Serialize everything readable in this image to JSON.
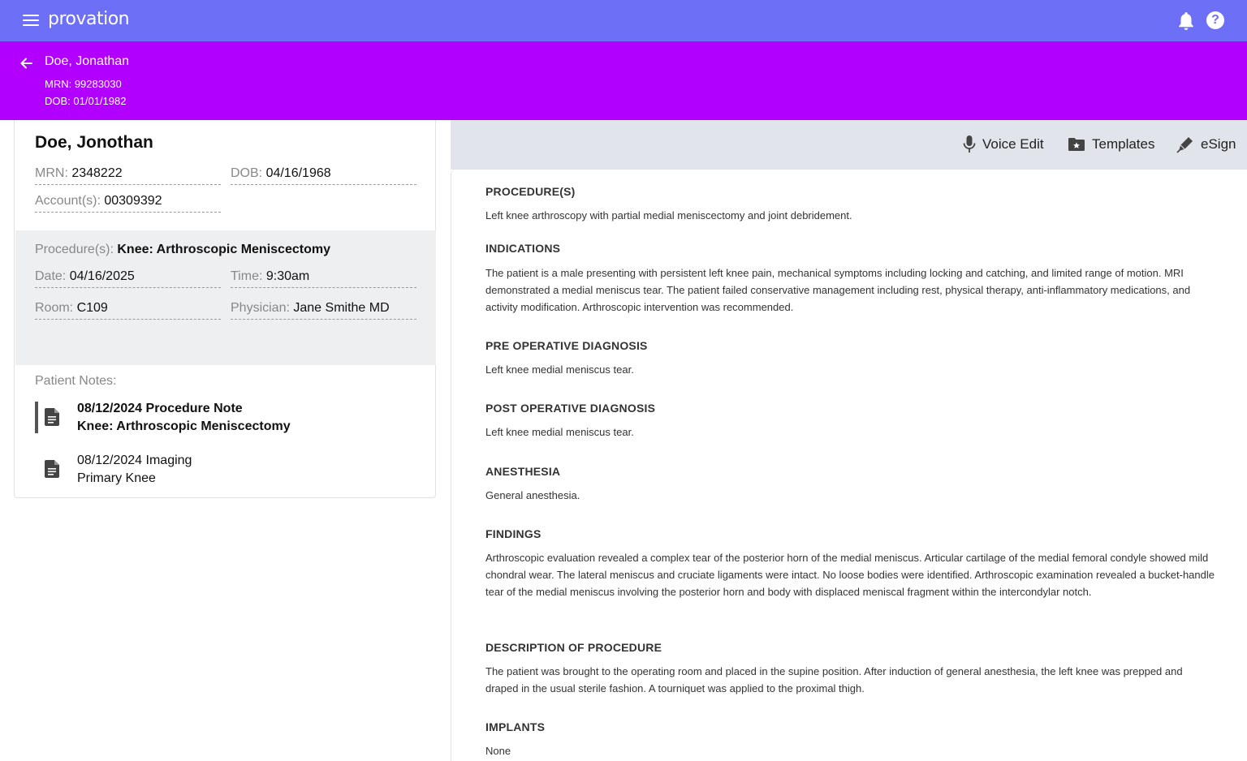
{
  "app": {
    "logo": "provation",
    "menu_icon": "hamburger-menu-icon",
    "bell_icon": "bell-icon",
    "help_icon": "help-icon",
    "help_glyph": "?"
  },
  "patient_header": {
    "name": "Doe, Jonathan",
    "mrn": "MRN: 99283030",
    "dob": "DOB: 01/01/1982"
  },
  "patient_card": {
    "name": "Doe, Jonothan",
    "mrn_label": "MRN: ",
    "mrn_value": "2348222",
    "dob_label": "DOB: ",
    "dob_value": "04/16/1968",
    "account_label": "Account(s): ",
    "account_value": "00309392",
    "procedure_label": "Procedure(s): ",
    "procedure_value": "Knee: Arthroscopic Meniscectomy",
    "date_label": "Date: ",
    "date_value": "04/16/2025",
    "time_label": "Time: ",
    "time_value": "9:30am",
    "room_label": "Room: ",
    "room_value": "C109",
    "physician_label": "Physician: ",
    "physician_value": "Jane Smithe MD",
    "notes_label": "Patient Notes:",
    "notes": [
      {
        "line1": "08/12/2024 Procedure Note",
        "line2": "Knee: Arthroscopic Meniscectomy",
        "active": true
      },
      {
        "line1": "08/12/2024 Imaging",
        "line2": "Primary Knee",
        "active": false
      }
    ]
  },
  "toolbar": {
    "voice_edit": "Voice Edit",
    "templates": "Templates",
    "esign": "eSign"
  },
  "report": {
    "procedures_h": "PROCEDURE(S)",
    "procedures_p": "Left knee arthroscopy with partial medial meniscectomy and joint debridement.",
    "indications_h": "INDICATIONS",
    "indications_p": "The patient is a male presenting with persistent left knee pain, mechanical symptoms including locking and catching, and limited range of motion. MRI demonstrated a medial meniscus tear. The patient failed conservative management including rest, physical therapy, anti-inflammatory medications, and activity modification. Arthroscopic intervention was recommended.",
    "preop_h": "PRE OPERATIVE DIAGNOSIS",
    "preop_p": "Left knee medial meniscus tear.",
    "postop_h": "POST OPERATIVE DIAGNOSIS",
    "postop_p": "Left knee medial meniscus tear.",
    "anesthesia_h": "ANESTHESIA",
    "anesthesia_p": "General anesthesia.",
    "findings_h": "FINDINGS",
    "findings_p": "Arthroscopic evaluation revealed a complex tear of the posterior horn of the medial meniscus. Articular cartilage of the medial femoral condyle showed mild chondral wear. The lateral meniscus and cruciate ligaments were intact. No loose bodies were identified. Arthroscopic examination revealed a bucket-handle tear of the medial meniscus involving the posterior horn and body with displaced meniscal fragment within the intercondylar notch.",
    "description_h": "DESCRIPTION OF PROCEDURE",
    "description_p": "The patient was brought to the operating room and placed in the supine position. After induction of general anesthesia, the left knee was prepped and draped in the usual sterile fashion. A tourniquet was applied to the proximal thigh.",
    "implants_h": "IMPLANTS",
    "implants_p": "None"
  },
  "colors": {
    "appbar": "#6d6ff7",
    "patient_header": "#b200ff",
    "toolbar_bg": "#e1e4ea",
    "procedure_block": "#eeeff1"
  }
}
